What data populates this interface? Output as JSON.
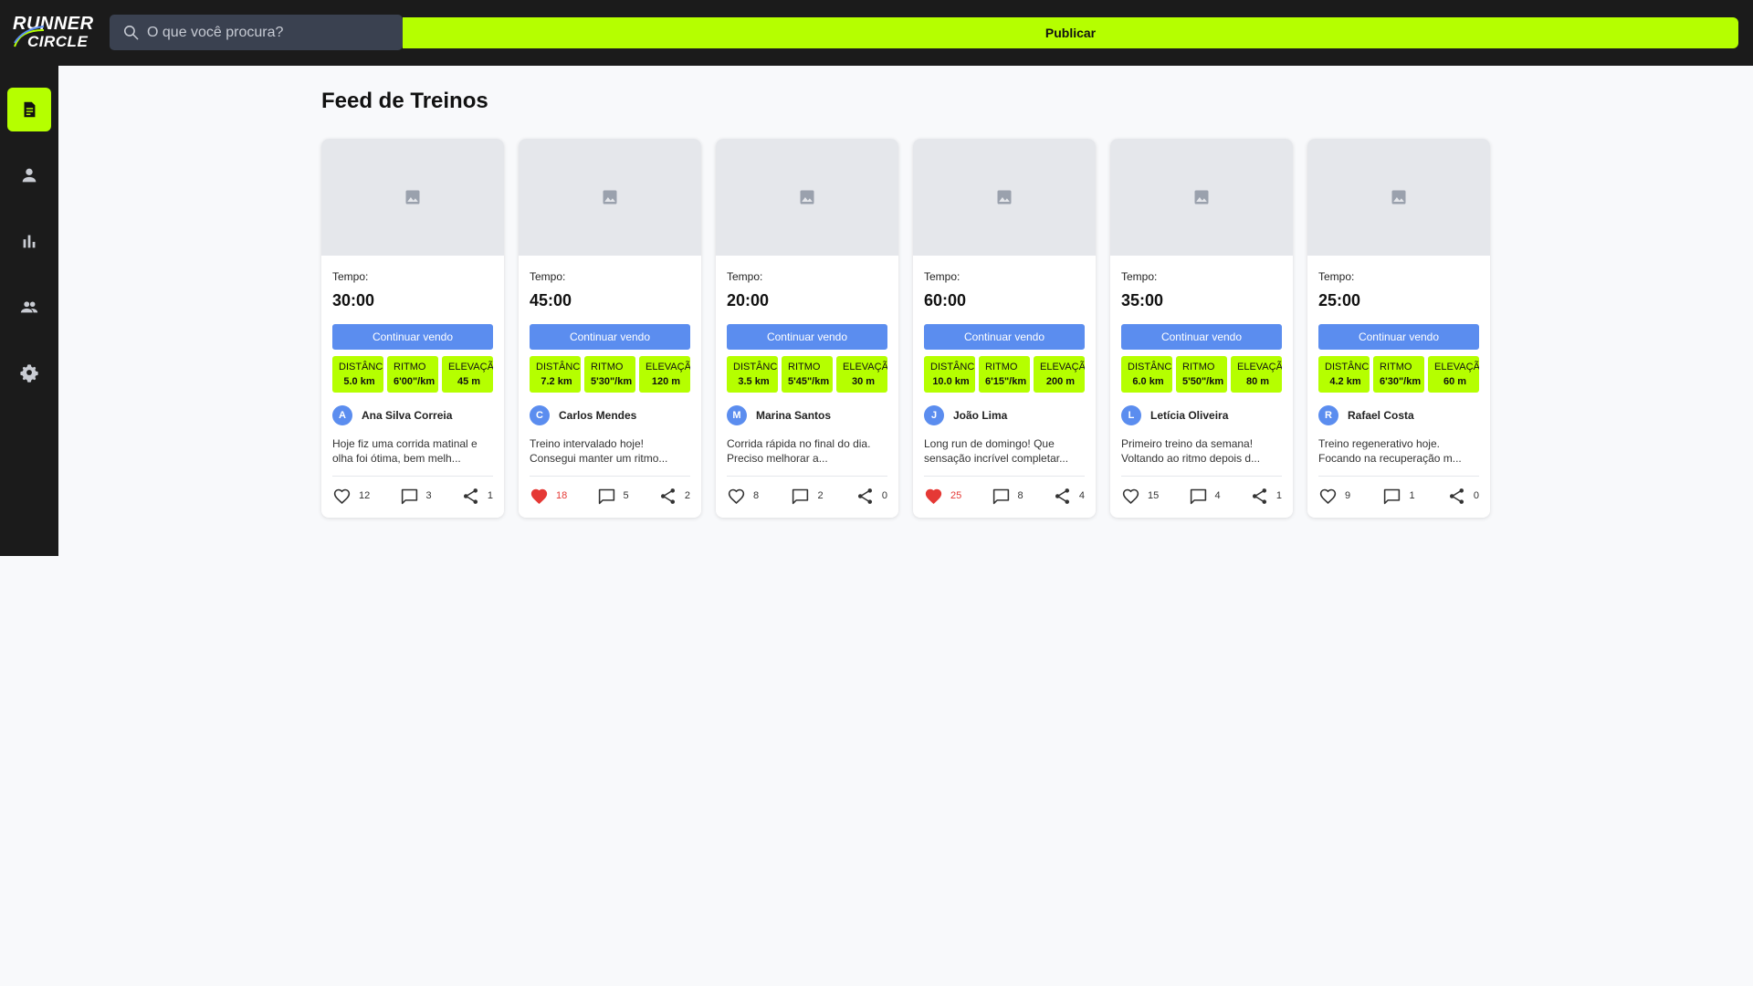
{
  "header": {
    "logo_line1": "RUNNER",
    "logo_line2": "CIRCLE",
    "search_placeholder": "O que você procura?",
    "publish_label": "Publicar"
  },
  "sidebar": {
    "items": [
      {
        "icon": "feed-icon",
        "active": true
      },
      {
        "icon": "profile-icon",
        "active": false
      },
      {
        "icon": "stats-icon",
        "active": false
      },
      {
        "icon": "community-icon",
        "active": false
      },
      {
        "icon": "settings-icon",
        "active": false
      }
    ]
  },
  "colors": {
    "accent": "#b5ff00",
    "button_blue": "#5b8def",
    "dark": "#1b1b1b",
    "like_red": "#e53935"
  },
  "main": {
    "title": "Feed de Treinos",
    "time_label": "Tempo:",
    "continue_label": "Continuar vendo",
    "stat_labels": {
      "distance": "DISTÂNCIA",
      "pace": "RITMO",
      "elevation": "ELEVAÇÃO"
    },
    "cards": [
      {
        "time": "30:00",
        "distance": "5.0 km",
        "pace": "6'00\"/km",
        "elevation": "45 m",
        "initial": "A",
        "author": "Ana Silva Correia",
        "description": "Hoje fiz uma corrida matinal e olha foi ótima, bem melh...",
        "likes": "12",
        "comments": "3",
        "shares": "1",
        "liked": false
      },
      {
        "time": "45:00",
        "distance": "7.2 km",
        "pace": "5'30\"/km",
        "elevation": "120 m",
        "initial": "C",
        "author": "Carlos Mendes",
        "description": "Treino intervalado hoje! Consegui manter um ritmo...",
        "likes": "18",
        "comments": "5",
        "shares": "2",
        "liked": true
      },
      {
        "time": "20:00",
        "distance": "3.5 km",
        "pace": "5'45\"/km",
        "elevation": "30 m",
        "initial": "M",
        "author": "Marina Santos",
        "description": "Corrida rápida no final do dia. Preciso melhorar a...",
        "likes": "8",
        "comments": "2",
        "shares": "0",
        "liked": false
      },
      {
        "time": "60:00",
        "distance": "10.0 km",
        "pace": "6'15\"/km",
        "elevation": "200 m",
        "initial": "J",
        "author": "João Lima",
        "description": "Long run de domingo! Que sensação incrível completar...",
        "likes": "25",
        "comments": "8",
        "shares": "4",
        "liked": true
      },
      {
        "time": "35:00",
        "distance": "6.0 km",
        "pace": "5'50\"/km",
        "elevation": "80 m",
        "initial": "L",
        "author": "Letícia Oliveira",
        "description": "Primeiro treino da semana! Voltando ao ritmo depois d...",
        "likes": "15",
        "comments": "4",
        "shares": "1",
        "liked": false
      },
      {
        "time": "25:00",
        "distance": "4.2 km",
        "pace": "6'30\"/km",
        "elevation": "60 m",
        "initial": "R",
        "author": "Rafael Costa",
        "description": "Treino regenerativo hoje. Focando na recuperação m...",
        "likes": "9",
        "comments": "1",
        "shares": "0",
        "liked": false
      }
    ]
  }
}
